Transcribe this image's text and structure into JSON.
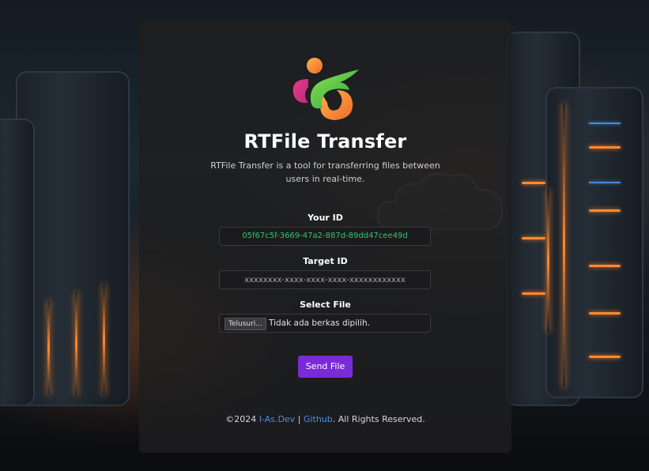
{
  "app": {
    "title": "RTFile Transfer",
    "description": "RTFile Transfer is a tool for transferring files between users in real-time."
  },
  "logo": {
    "icon": "rtfile-logo-icon"
  },
  "your_id": {
    "label": "Your ID",
    "value": "05f67c5f-3669-47a2-887d-89dd47cee49d"
  },
  "target_id": {
    "label": "Target ID",
    "placeholder": "xxxxxxxx-xxxx-xxxx-xxxx-xxxxxxxxxxxx",
    "value": ""
  },
  "select_file": {
    "label": "Select File",
    "browse_label": "Telusuri...",
    "status": "Tidak ada berkas dipilih."
  },
  "send_button": {
    "label": "Send File"
  },
  "footer": {
    "copyright": "©2024",
    "author_link": "I-As.Dev",
    "separator": "|",
    "github_link": "Github",
    "rights": ". All Rights Reserved."
  },
  "colors": {
    "accent": "#7a2bd8",
    "id_text": "#33c46b",
    "link": "#4a90e2"
  }
}
